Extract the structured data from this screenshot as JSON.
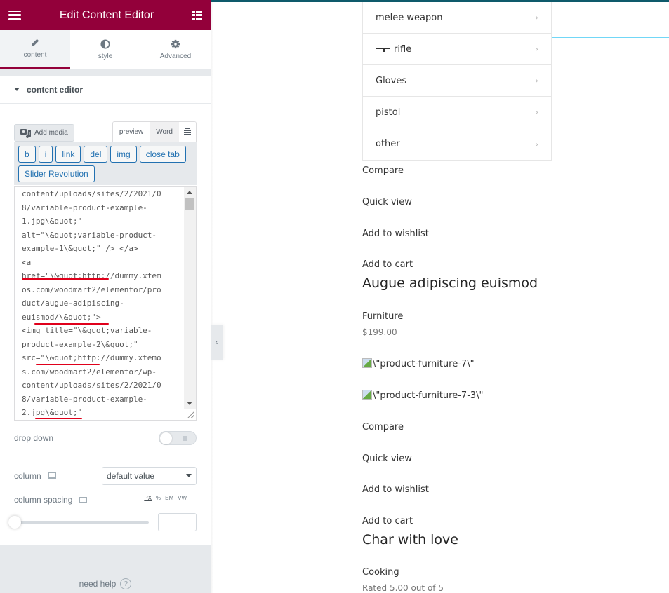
{
  "panel": {
    "title": "Edit Content Editor",
    "tabs": [
      {
        "label": "content",
        "icon": "pencil-icon",
        "active": true
      },
      {
        "label": "style",
        "icon": "half-circle-icon",
        "active": false
      },
      {
        "label": "Advanced",
        "icon": "gear-icon",
        "active": false
      }
    ],
    "section_title": "content editor",
    "editor": {
      "add_media_label": "Add media",
      "mode_tabs": [
        "preview",
        "Word"
      ],
      "toolbar_buttons": [
        "b",
        "i",
        "link",
        "del",
        "img",
        "close tab",
        "Slider Revolution"
      ],
      "code_lines": [
        "content/uploads/sites/2/2021/0",
        "8/variable-product-example-",
        "1.jpg\\&quot;\"",
        "alt=\"\\&quot;variable-product-",
        "example-1\\&quot;\" /> </a>",
        "<a",
        "href=\"\\&quot;http://dummy.xtem",
        "os.com/woodmart2/elementor/pro",
        "duct/augue-adipiscing-",
        "euismod/\\&quot;\">",
        "<img title=\"\\&quot;variable-",
        "product-example-2\\&quot;\"",
        "src=\"\\&quot;http://dummy.xtemo",
        "s.com/woodmart2/elementor/wp-",
        "content/uploads/sites/2/2021/0",
        "8/variable-product-example-",
        "2.jpg\\&quot;\""
      ]
    },
    "drop_down_label": "drop down",
    "drop_down_on": false,
    "column_label": "column",
    "column_value": "default value",
    "column_spacing_label": "column spacing",
    "units": [
      "PX",
      "%",
      "EM",
      "VW"
    ],
    "active_unit": "PX",
    "column_spacing_value": "",
    "need_help": "need help",
    "help_glyph": "?"
  },
  "collapse_glyph": "‹",
  "preview": {
    "menu": [
      {
        "label": "melee weapon",
        "icon": null
      },
      {
        "label": "rifle",
        "icon": "rifle-icon"
      },
      {
        "label": "Gloves",
        "icon": null
      },
      {
        "label": "pistol",
        "icon": null
      },
      {
        "label": "other",
        "icon": null
      }
    ],
    "chevron": "›",
    "products": [
      {
        "actions": [
          "Compare",
          "Quick view",
          "Add to wishlist",
          "Add to cart"
        ]
      },
      {
        "title": "Augue adipiscing euismod",
        "category": "Furniture",
        "price": "$199.00",
        "images": [
          "\\\"product-furniture-7\\\"",
          "\\\"product-furniture-7-3\\\""
        ],
        "actions": [
          "Compare",
          "Quick view",
          "Add to wishlist",
          "Add to cart"
        ]
      },
      {
        "title": "Char with love",
        "category": "Cooking",
        "rating": "Rated 5.00 out of 5"
      }
    ]
  }
}
